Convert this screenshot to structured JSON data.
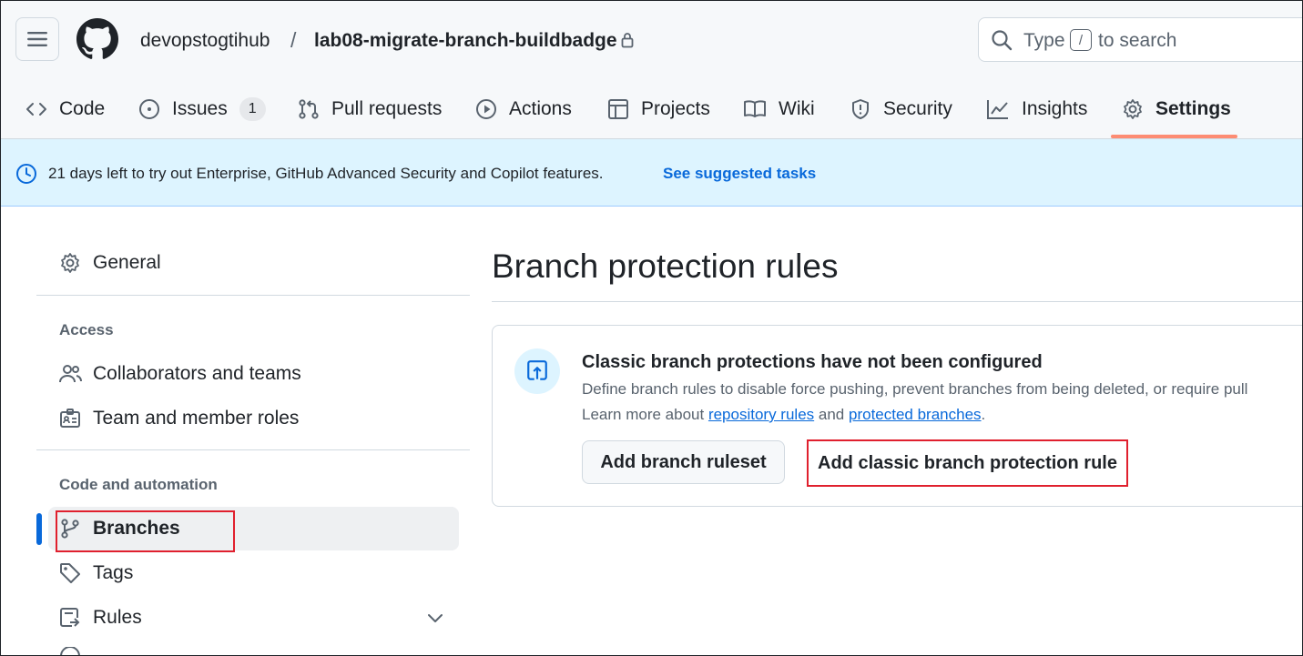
{
  "header": {
    "owner": "devopstogtihub",
    "separator": "/",
    "repo": "lab08-migrate-branch-buildbadge",
    "search": {
      "prefix": "Type",
      "key": "/",
      "suffix": "to search"
    }
  },
  "tabs": [
    {
      "label": "Code",
      "icon": "code-icon"
    },
    {
      "label": "Issues",
      "icon": "issue-opened-icon",
      "count": "1"
    },
    {
      "label": "Pull requests",
      "icon": "git-pull-request-icon"
    },
    {
      "label": "Actions",
      "icon": "play-icon"
    },
    {
      "label": "Projects",
      "icon": "table-icon"
    },
    {
      "label": "Wiki",
      "icon": "book-icon"
    },
    {
      "label": "Security",
      "icon": "shield-icon"
    },
    {
      "label": "Insights",
      "icon": "graph-icon"
    },
    {
      "label": "Settings",
      "icon": "gear-icon",
      "active": true
    }
  ],
  "banner": {
    "message": "21 days left to try out Enterprise, GitHub Advanced Security and Copilot features.",
    "link": "See suggested tasks"
  },
  "sidebar": {
    "general": "General",
    "access_heading": "Access",
    "access_items": [
      "Collaborators and teams",
      "Team and member roles"
    ],
    "code_heading": "Code and automation",
    "code_items": [
      "Branches",
      "Tags",
      "Rules"
    ]
  },
  "main": {
    "title": "Branch protection rules",
    "card": {
      "heading": "Classic branch protections have not been configured",
      "description": "Define branch rules to disable force pushing, prevent branches from being deleted, or require pull",
      "learn_prefix": "Learn more about",
      "link1": "repository rules",
      "learn_and": "and",
      "link2": "protected branches",
      "learn_suffix": ".",
      "btn_ruleset": "Add branch ruleset",
      "btn_classic": "Add classic branch protection rule"
    }
  },
  "colors": {
    "accent": "#0969da",
    "tab_underline": "#fd8c73",
    "banner_bg": "#ddf4ff",
    "highlight_box": "#e0202e"
  }
}
